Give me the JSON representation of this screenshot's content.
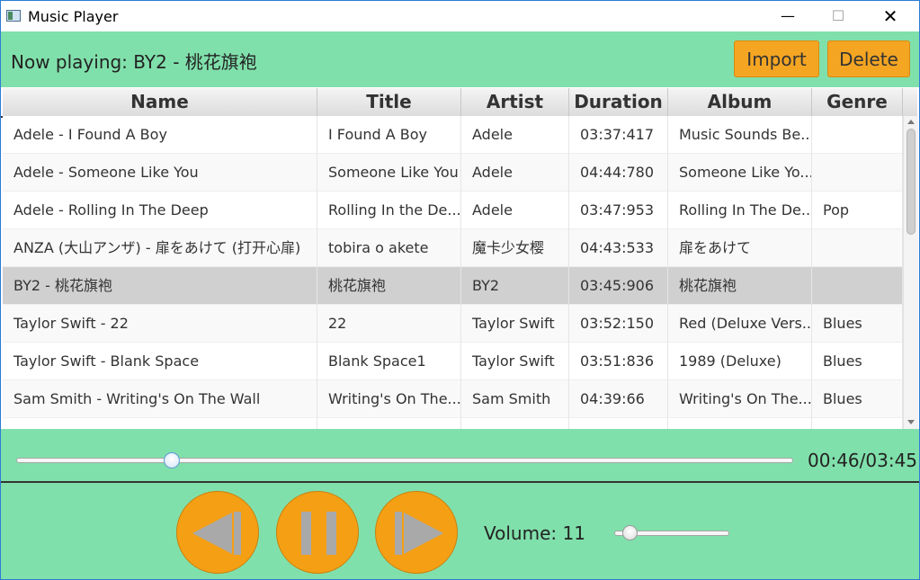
{
  "window": {
    "title": "Music Player",
    "minimize_glyph": "—",
    "maximize_glyph": "☐",
    "close_glyph": "✕"
  },
  "header": {
    "now_playing": "Now playing: BY2 - 桃花旗袍",
    "import_label": "Import",
    "delete_label": "Delete"
  },
  "table": {
    "columns": [
      "Name",
      "Title",
      "Artist",
      "Duration",
      "Album",
      "Genre"
    ],
    "rows": [
      [
        "Adele - I Found A Boy",
        "I Found A Boy",
        "Adele",
        "03:37:417",
        "Music Sounds Be...",
        ""
      ],
      [
        "Adele - Someone Like You",
        "Someone Like You",
        "Adele",
        "04:44:780",
        "Someone Like Yo...",
        ""
      ],
      [
        "Adele - Rolling In The Deep",
        "Rolling In the De...",
        "Adele",
        "03:47:953",
        "Rolling In The De...",
        "Pop"
      ],
      [
        "ANZA (大山アンザ) - 扉をあけて (打开心扉)",
        "tobira o akete",
        "魔卡少女樱",
        "04:43:533",
        "扉をあけて",
        ""
      ],
      [
        "BY2 - 桃花旗袍",
        "桃花旗袍",
        "BY2",
        "03:45:906",
        "桃花旗袍",
        ""
      ],
      [
        "Taylor Swift - 22",
        "22",
        "Taylor Swift",
        "03:52:150",
        "Red (Deluxe Vers...",
        "Blues"
      ],
      [
        "Taylor Swift - Blank Space",
        "Blank Space1",
        "Taylor Swift",
        "03:51:836",
        "1989 (Deluxe)",
        "Blues"
      ],
      [
        "Sam Smith - Writing's On The Wall",
        "Writing's On The...",
        "Sam Smith",
        "04:39:66",
        "Writing's On The...",
        "Blues"
      ],
      [
        "",
        "",
        "",
        "",
        "",
        ""
      ]
    ],
    "selected_row_index": 4
  },
  "playback": {
    "time": "00:46/03:45",
    "position_fraction": 0.2
  },
  "controls": {
    "accent_color": "#f59f15",
    "previous_icon": "previous-icon",
    "pause_icon": "pause-icon",
    "next_icon": "next-icon",
    "volume_label": "Volume: 11",
    "volume_value": 11
  },
  "colors": {
    "panel_background": "#80e0ab",
    "button_orange": "#f4a522",
    "selected_row": "#d0d0d0"
  }
}
